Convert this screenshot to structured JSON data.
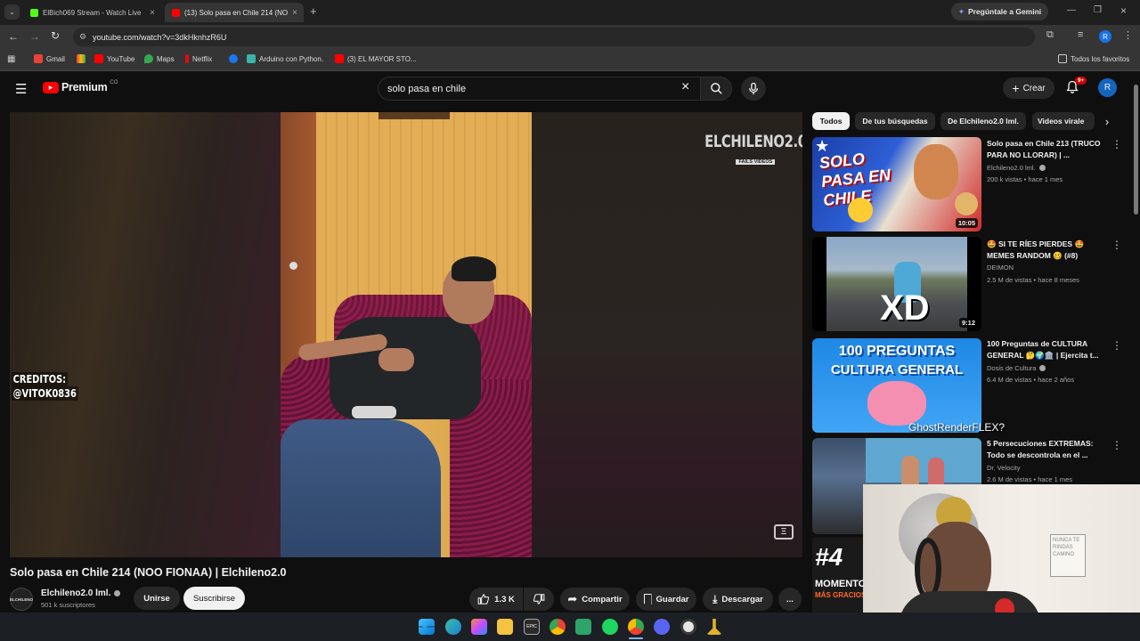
{
  "browser": {
    "tabs": [
      {
        "label": "ElBich069 Stream - Watch Live",
        "active": false
      },
      {
        "label": "(13) Solo pasa en Chile 214 (NO",
        "active": true
      }
    ],
    "new_tab": "+",
    "gemini": "Pregúntale a Gemini",
    "url": "youtube.com/watch?v=3dkHknhzR6U",
    "profile_initial": "R",
    "bookmarks": [
      {
        "label": "Gmail",
        "color": "#ea4335"
      },
      {
        "label": "YouTube",
        "color": "#ff0000"
      },
      {
        "label": "Maps",
        "color": "#34a853"
      },
      {
        "label": "Netflix",
        "color": "#e50914"
      },
      {
        "label": "",
        "color": "#1877f2"
      },
      {
        "label": "Arduino con Python.",
        "color": "#3bb3a7"
      },
      {
        "label": "(3) EL MAYOR STO...",
        "color": "#ff0000"
      }
    ],
    "all_bookmarks": "Todos los favoritos"
  },
  "youtube": {
    "logo": "Premium",
    "country": "CO",
    "search_value": "solo pasa en chile",
    "create": "Crear",
    "notif_count": "9+",
    "avatar": "R"
  },
  "video": {
    "watermark": "ELCHILENO2.0",
    "watermark_sub": "FAILS VIDEOS",
    "credits_1": "CREDITOS:",
    "credits_2": "@VITOK0836",
    "title": "Solo pasa en Chile 214 (NOO FIONAA) | Elchileno2.0",
    "channel": "Elchileno2.0 lml.",
    "channel_logo": "ELCHILENO",
    "subscribers": "501 k suscriptores",
    "join": "Unirse",
    "subscribe": "Suscribirse",
    "likes": "1.3 K",
    "share": "Compartir",
    "save": "Guardar",
    "download": "Descargar",
    "more": "..."
  },
  "sidebar": {
    "chips": [
      "Todos",
      "De tus búsquedas",
      "De Elchileno2.0 lml.",
      "Videos virale"
    ],
    "videos": [
      {
        "title": "Solo pasa en Chile 213 (TRUCO PARA NO LLORAR) | ...",
        "channel": "Elchileno2.0 lml.",
        "meta": "200 k vistas • hace 1 mes",
        "duration": "10:05",
        "thumb_text": "SOLO PASA EN CHILE"
      },
      {
        "title": "🤩 SI TE RÍES PIERDES 🤩 MEMES RANDOM 🥴 (#8)",
        "channel": "DEIMON",
        "meta": "2.5 M de vistas • hace 8 meses",
        "duration": "9:12",
        "thumb_text": "XD"
      },
      {
        "title": "100 Preguntas de CULTURA GENERAL 🤔🌍🏛️ | Ejercita t...",
        "channel": "Dosis de Cultura",
        "meta": "6.4 M de vistas • hace 2 años",
        "duration": "",
        "thumb_text_1": "100 PREGUNTAS",
        "thumb_text_2": "CULTURA GENERAL"
      },
      {
        "title": "5 Persecuciones EXTREMAS: Todo se descontrola en el ...",
        "channel": "Dr. Velocity",
        "meta": "2.6 M de vistas • hace 1 mes",
        "duration": ""
      }
    ],
    "overlay_text": "GhostRenderFLEX?",
    "partial_thumb_1": "#4",
    "partial_thumb_2": "MOMENTOS",
    "partial_thumb_3": "MÁS GRACIOS"
  },
  "webcam": {
    "note_text": "NUNCA TE RINDAS CAMINO"
  },
  "taskbar": {
    "icons": [
      "windows-start",
      "edge",
      "copilot",
      "file-explorer",
      "epic-games",
      "chrome",
      "notepad",
      "spotify",
      "chrome-dev",
      "discord",
      "github",
      "tool"
    ]
  }
}
